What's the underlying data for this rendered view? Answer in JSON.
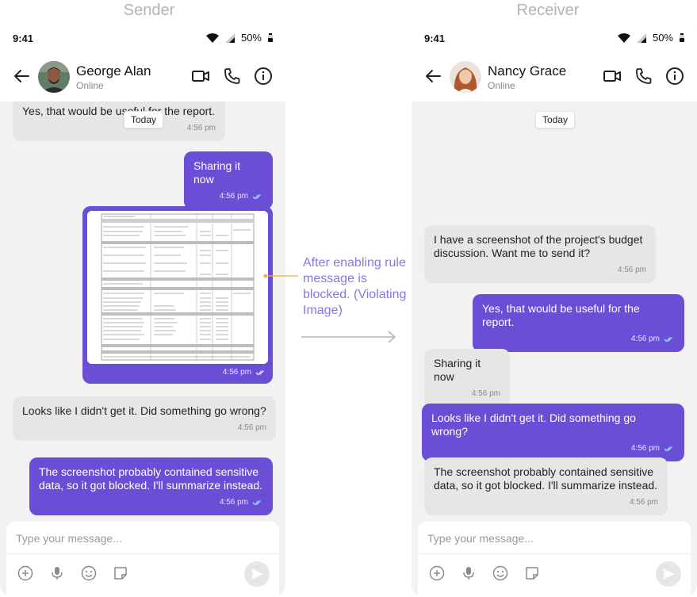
{
  "labels": {
    "sender": "Sender",
    "receiver": "Receiver"
  },
  "annotation": "After enabling rule message is blocked. (Violating Image)",
  "status_bar": {
    "time": "9:41",
    "battery": "50%"
  },
  "composer": {
    "placeholder": "Type your message..."
  },
  "sender_phone": {
    "contact_name": "George Alan",
    "contact_status": "Online",
    "date_chip": "Today",
    "messages": [
      {
        "text": "Yes, that would be useful for the report.",
        "time": "4:56 pm"
      },
      {
        "text": "Sharing it now",
        "time": "4:56 pm"
      },
      {
        "text": "",
        "time": "4:56 pm"
      },
      {
        "text": "Looks like I didn't get it. Did something go wrong?",
        "time": "4:56 pm"
      },
      {
        "text": "The screenshot probably contained sensitive data, so it got blocked. I'll summarize instead.",
        "time": "4:56 pm"
      }
    ]
  },
  "receiver_phone": {
    "contact_name": "Nancy Grace",
    "contact_status": "Online",
    "date_chip": "Today",
    "messages": [
      {
        "text": "I have a screenshot of the project's budget discussion. Want me to send it?",
        "time": "4:56 pm"
      },
      {
        "text": "Yes, that would be useful for the report.",
        "time": "4:56 pm"
      },
      {
        "text": "Sharing it now",
        "time": "4:56 pm"
      },
      {
        "text": "Looks like I didn't get it. Did something go wrong?",
        "time": "4:56 pm"
      },
      {
        "text": "The screenshot probably contained sensitive data, so it got blocked. I'll summarize instead.",
        "time": "4:56 pm"
      }
    ]
  },
  "colors": {
    "accent": "#6a4fd6",
    "annotation": "#8d74e6",
    "incoming_bubble": "#e6e6e6",
    "background": "#f2f2f2"
  },
  "icons": [
    "wifi-icon",
    "signal-icon",
    "battery-icon",
    "back-arrow-icon",
    "video-call-icon",
    "phone-icon",
    "info-icon",
    "add-icon",
    "microphone-icon",
    "emoji-icon",
    "sticker-icon",
    "send-icon",
    "double-check-icon"
  ]
}
